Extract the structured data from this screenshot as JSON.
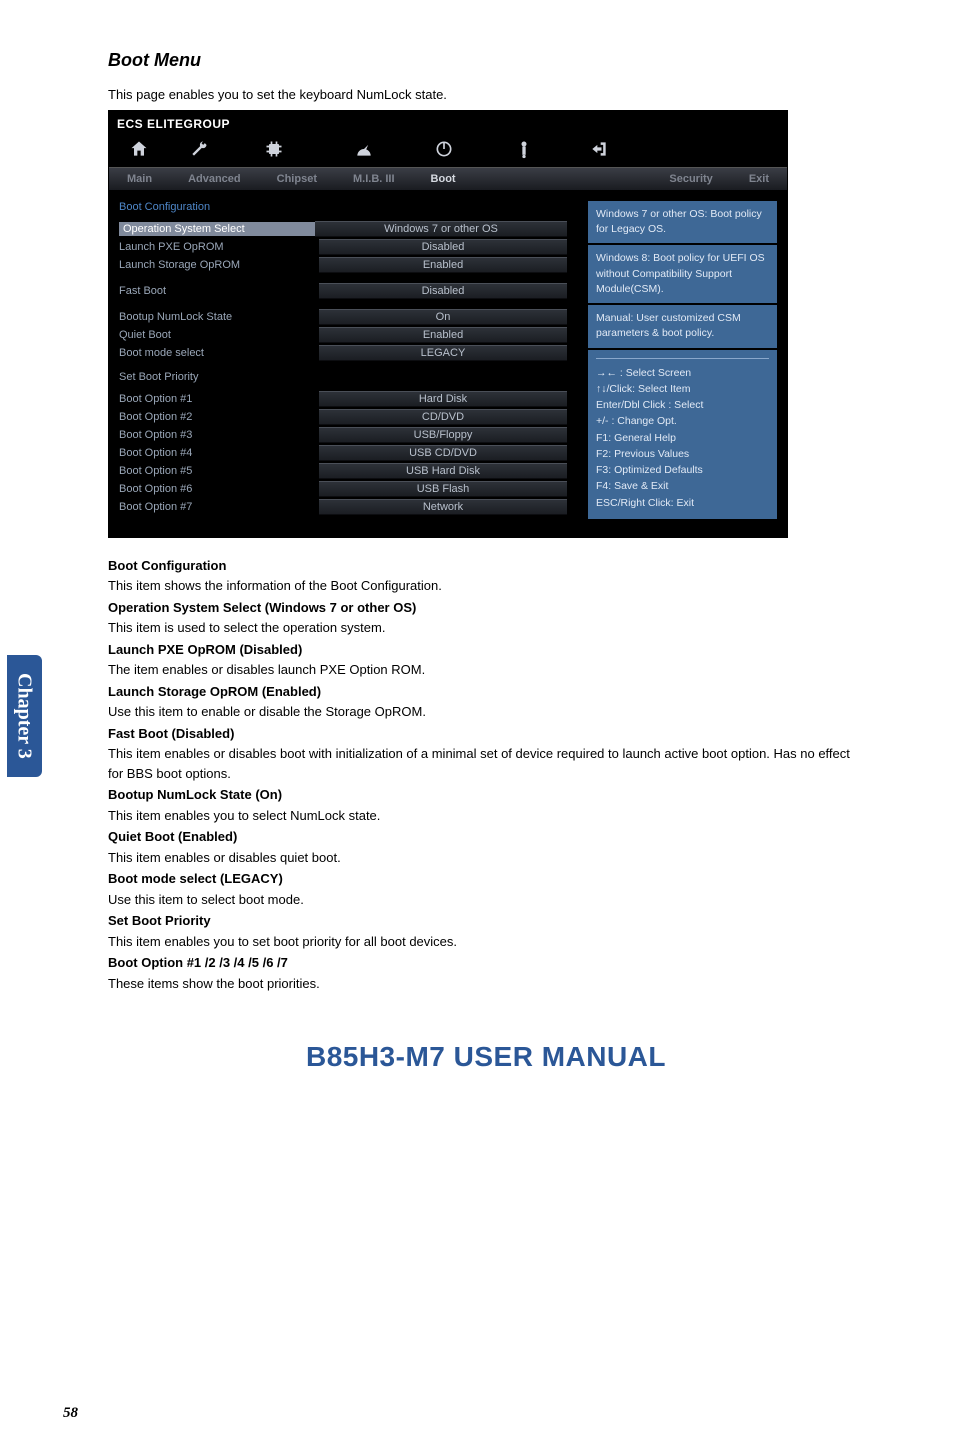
{
  "chapter_tab": "Chapter 3",
  "page_title": "Boot Menu",
  "intro": "This page enables you to set the keyboard NumLock state.",
  "bios": {
    "brand": "ECS ELITEGROUP",
    "tabs": [
      "Main",
      "Advanced",
      "Chipset",
      "M.I.B. III",
      "Boot",
      "Security",
      "Exit"
    ],
    "active_tab_index": 4,
    "boot_config_title": "Boot Configuration",
    "rows1": [
      {
        "label": "Operation System Select",
        "value": "Windows 7 or other OS",
        "selected": true
      },
      {
        "label": "Launch PXE OpROM",
        "value": "Disabled"
      },
      {
        "label": "Launch Storage OpROM",
        "value": "Enabled"
      }
    ],
    "fast_boot": {
      "label": "Fast Boot",
      "value": "Disabled"
    },
    "rows2": [
      {
        "label": "Bootup NumLock State",
        "value": "On"
      },
      {
        "label": "Quiet Boot",
        "value": "Enabled"
      },
      {
        "label": "Boot mode select",
        "value": "LEGACY"
      }
    ],
    "set_boot_title": "Set Boot Priority",
    "boot_options": [
      {
        "label": "Boot Option #1",
        "value": "Hard Disk"
      },
      {
        "label": "Boot Option #2",
        "value": "CD/DVD"
      },
      {
        "label": "Boot Option #3",
        "value": "USB/Floppy"
      },
      {
        "label": "Boot Option #4",
        "value": "USB CD/DVD"
      },
      {
        "label": "Boot Option #5",
        "value": "USB Hard Disk"
      },
      {
        "label": "Boot Option #6",
        "value": "USB Flash"
      },
      {
        "label": "Boot Option #7",
        "value": "Network"
      }
    ],
    "help1": "Windows 7 or other OS: Boot policy for Legacy OS.",
    "help2": "Windows 8: Boot policy for UEFI OS without Compatibility Support Module(CSM).",
    "help3": "Manual: User customized CSM parameters & boot policy.",
    "tips": [
      "→← : Select Screen",
      "↑↓/Click: Select Item",
      "Enter/Dbl Click : Select",
      "+/- : Change Opt.",
      "F1: General Help",
      "F2: Previous Values",
      "F3: Optimized Defaults",
      "F4: Save & Exit",
      "ESC/Right Click: Exit"
    ]
  },
  "descriptions": [
    {
      "h": "Boot Configuration",
      "p": "This item shows the information of the Boot Configuration."
    },
    {
      "h": "Operation System Select (Windows 7 or other OS)",
      "p": "This item is used to select the operation system."
    },
    {
      "h": "Launch PXE OpROM (Disabled)",
      "p": "The item enables or disables launch PXE Option ROM."
    },
    {
      "h": "Launch Storage OpROM (Enabled)",
      "p": "Use this item to enable or disable the Storage OpROM."
    },
    {
      "h": "Fast Boot (Disabled)",
      "p": "This item enables or disables boot with initialization of a minimal set of device required to launch active boot option. Has no effect for BBS boot options."
    },
    {
      "h": "Bootup NumLock State (On)",
      "p": "This item enables you to select NumLock state."
    },
    {
      "h": "Quiet Boot (Enabled)",
      "p": "This item enables or disables quiet boot."
    },
    {
      "h": "Boot mode select (LEGACY)",
      "p": "Use this item to select boot mode."
    },
    {
      "h": "Set Boot Priority",
      "p": "This item enables you to set boot priority for all boot devices."
    },
    {
      "h": "Boot Option #1 /2 /3 /4 /5 /6 /7",
      "p": "These items show the boot priorities."
    }
  ],
  "manual_title": "B85H3-M7 USER MANUAL",
  "page_number": "58"
}
